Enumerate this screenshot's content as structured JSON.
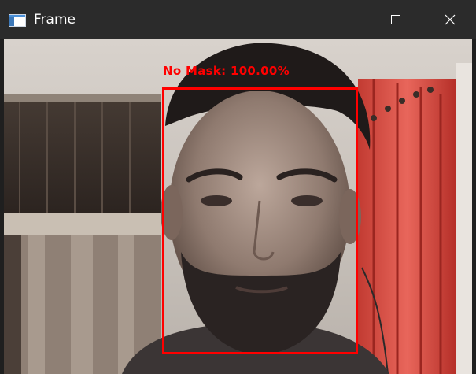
{
  "window": {
    "title": "Frame",
    "controls": {
      "minimize_icon": "minimize-icon",
      "maximize_icon": "maximize-icon",
      "close_icon": "close-icon"
    }
  },
  "detection": {
    "label": "No Mask: 100.00%",
    "color": "#ff0000"
  }
}
